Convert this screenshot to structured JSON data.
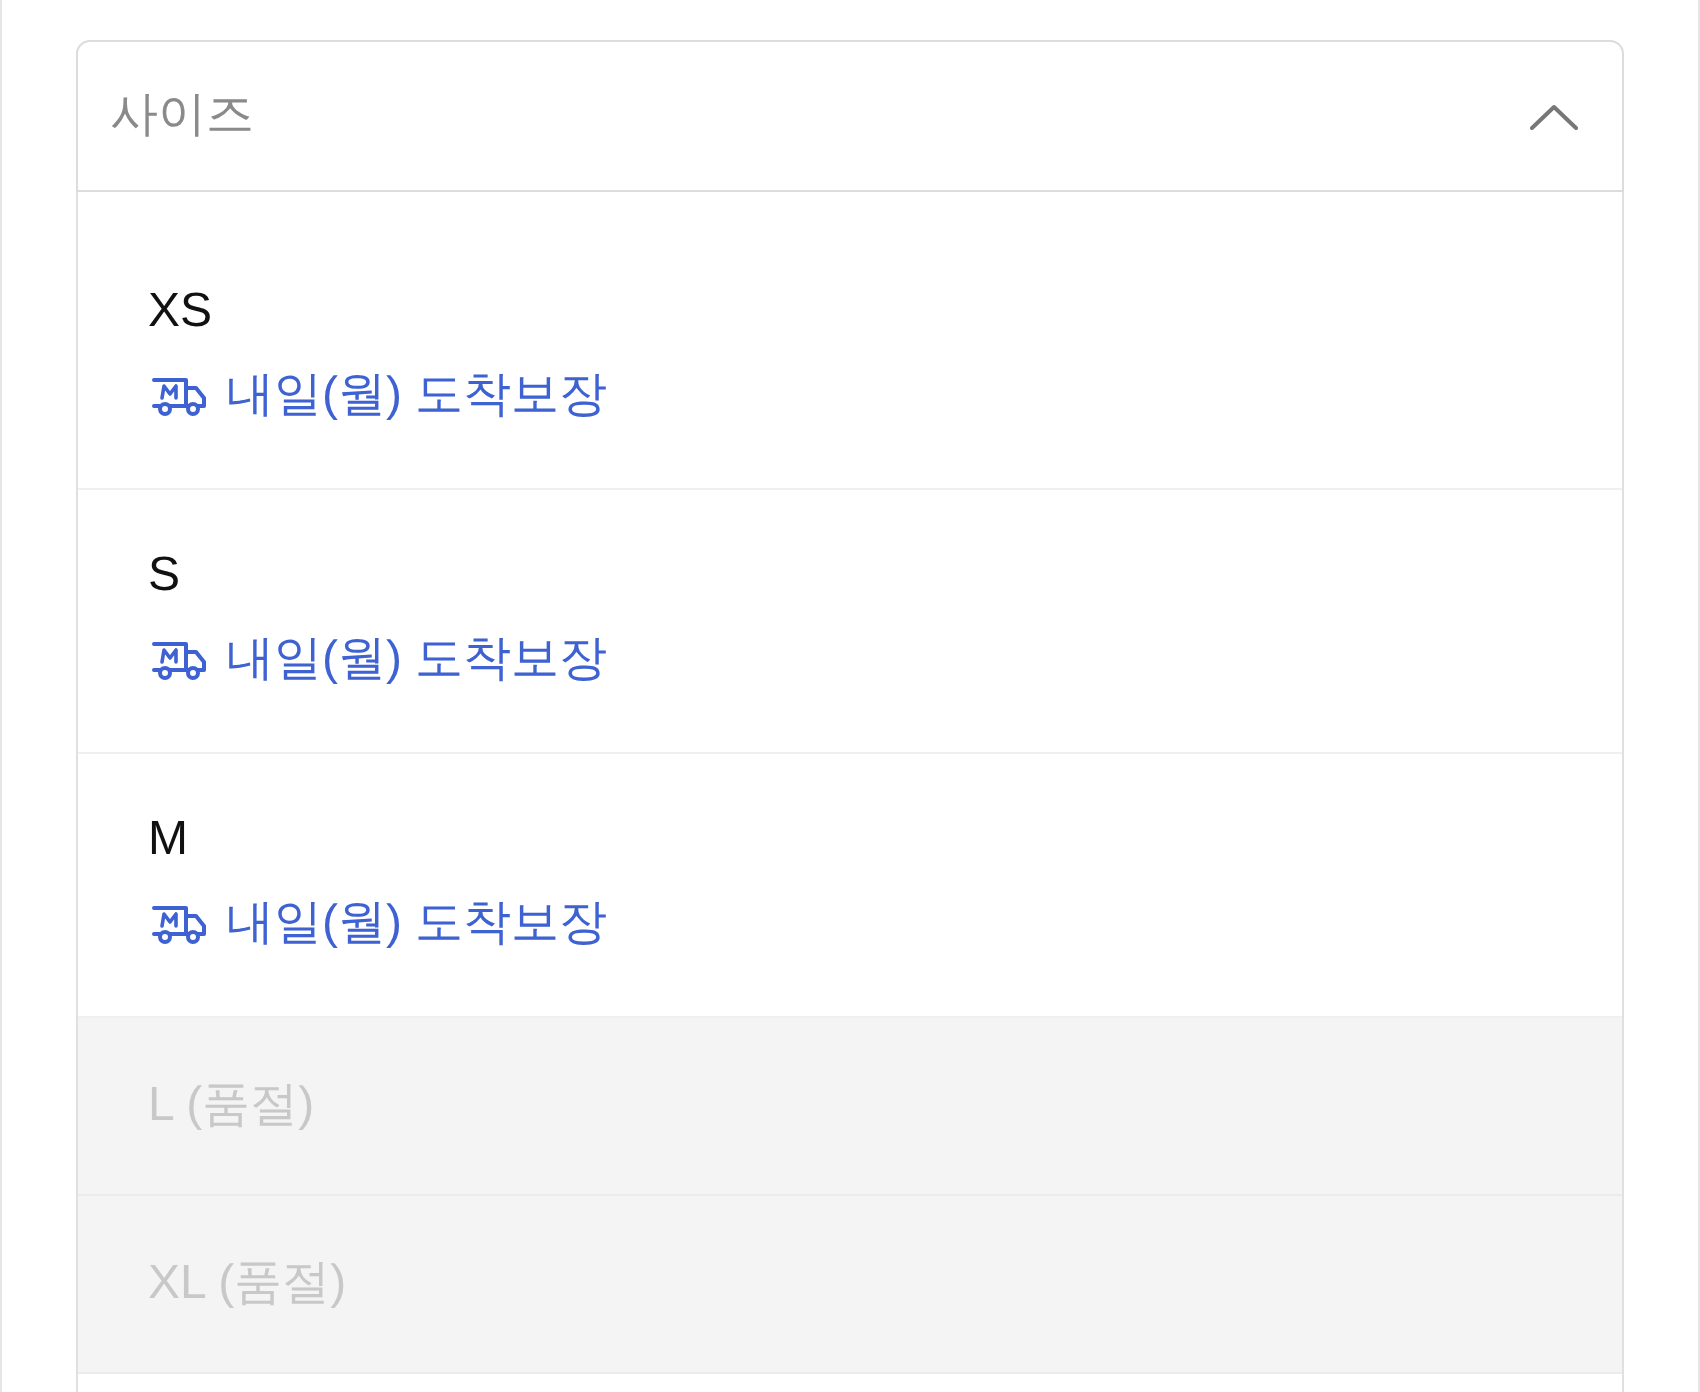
{
  "select": {
    "placeholder": "사이즈",
    "expanded": true
  },
  "options": [
    {
      "label": "XS",
      "sold_out": false,
      "delivery": "내일(월) 도착보장"
    },
    {
      "label": "S",
      "sold_out": false,
      "delivery": "내일(월) 도착보장"
    },
    {
      "label": "M",
      "sold_out": false,
      "delivery": "내일(월) 도착보장"
    },
    {
      "label": "L (품절)",
      "sold_out": true
    },
    {
      "label": "XL (품절)",
      "sold_out": true
    }
  ]
}
